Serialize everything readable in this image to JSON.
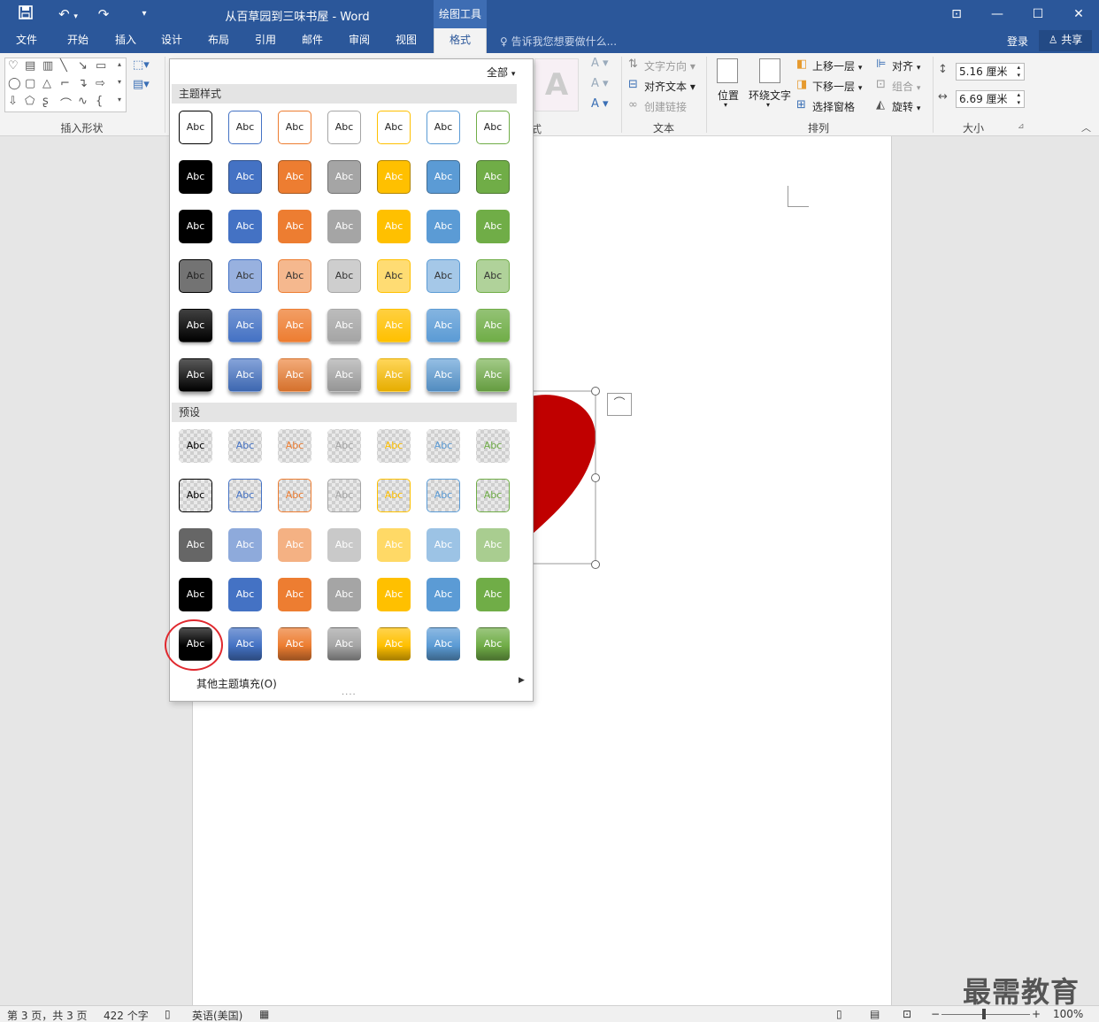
{
  "titlebar": {
    "title": "从百草园到三味书屋 - Word",
    "contextual_tab": "绘图工具"
  },
  "tabs": [
    "文件",
    "开始",
    "插入",
    "设计",
    "布局",
    "引用",
    "邮件",
    "审阅",
    "视图",
    "格式"
  ],
  "active_tab": "格式",
  "tell_me": "告诉我您想要做什么...",
  "account": {
    "login": "登录",
    "share": "共享"
  },
  "ribbon": {
    "insert_shapes_label": "插入形状",
    "text_group": {
      "text_direction": "文字方向",
      "align_text": "对齐文本",
      "create_link": "创建链接",
      "label": "文本"
    },
    "arrange_group": {
      "position": "位置",
      "wrap_text": "环绕文字",
      "bring_forward": "上移一层",
      "send_backward": "下移一层",
      "selection_pane": "选择窗格",
      "align": "对齐",
      "group": "组合",
      "rotate": "旋转",
      "label": "排列"
    },
    "size_group": {
      "height": "5.16 厘米",
      "width": "6.69 厘米",
      "label": "大小"
    },
    "style_fragment": "式"
  },
  "gallery": {
    "filter": "全部",
    "theme_styles_header": "主题样式",
    "presets_header": "预设",
    "swatch_text": "Abc",
    "more_fills": "其他主题填充(O)",
    "resize_grip": "····",
    "accent_colors": [
      "#000000",
      "#4472c4",
      "#ed7d31",
      "#a5a5a5",
      "#ffc000",
      "#5b9bd5",
      "#70ad47"
    ]
  },
  "document": {
    "shape_color": "#c00000"
  },
  "statusbar": {
    "page": "第 3 页，共 3 页",
    "words": "422 个字",
    "language": "英语(美国)",
    "zoom": "100%"
  },
  "watermark": "最需教育"
}
